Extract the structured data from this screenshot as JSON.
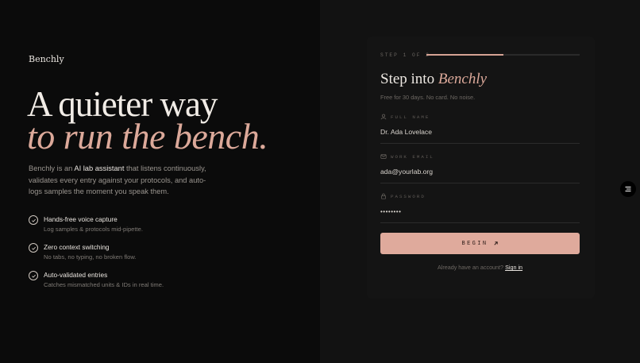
{
  "brand": "Benchly",
  "hero": {
    "line1": "A quieter way",
    "line2": "to run the bench.",
    "lead_pre": "Benchly is an ",
    "lead_highlight": "AI lab assistant",
    "lead_post": " that listens continuously, validates every entry against your protocols, and auto-logs samples the moment you speak them."
  },
  "features": [
    {
      "title": "Hands-free voice capture",
      "desc": "Log samples & protocols mid-pipette."
    },
    {
      "title": "Zero context switching",
      "desc": "No tabs, no typing, no broken flow."
    },
    {
      "title": "Auto-validated entries",
      "desc": "Catches mismatched units & IDs in real time."
    }
  ],
  "form": {
    "step": "STEP 1 OF 2",
    "progress": 0.5,
    "title_pre": "Step into ",
    "title_accent": "Benchly",
    "subtitle": "Free for 30 days. No card. No noise.",
    "fields": [
      {
        "label": "FULL NAME",
        "value": "Dr. Ada Lovelace",
        "icon": "user-icon"
      },
      {
        "label": "WORK EMAIL",
        "value": "ada@yourlab.org",
        "icon": "mail-icon"
      },
      {
        "label": "PASSWORD",
        "value": "••••••••",
        "icon": "lock-icon"
      }
    ],
    "button": "BEGIN",
    "footer_text": "Already have an account? ",
    "footer_link": "Sign in"
  },
  "colors": {
    "accent": "#dca99a",
    "button": "#dfaa9c",
    "bg_left": "#0b0b0b",
    "bg_right": "#121212"
  }
}
